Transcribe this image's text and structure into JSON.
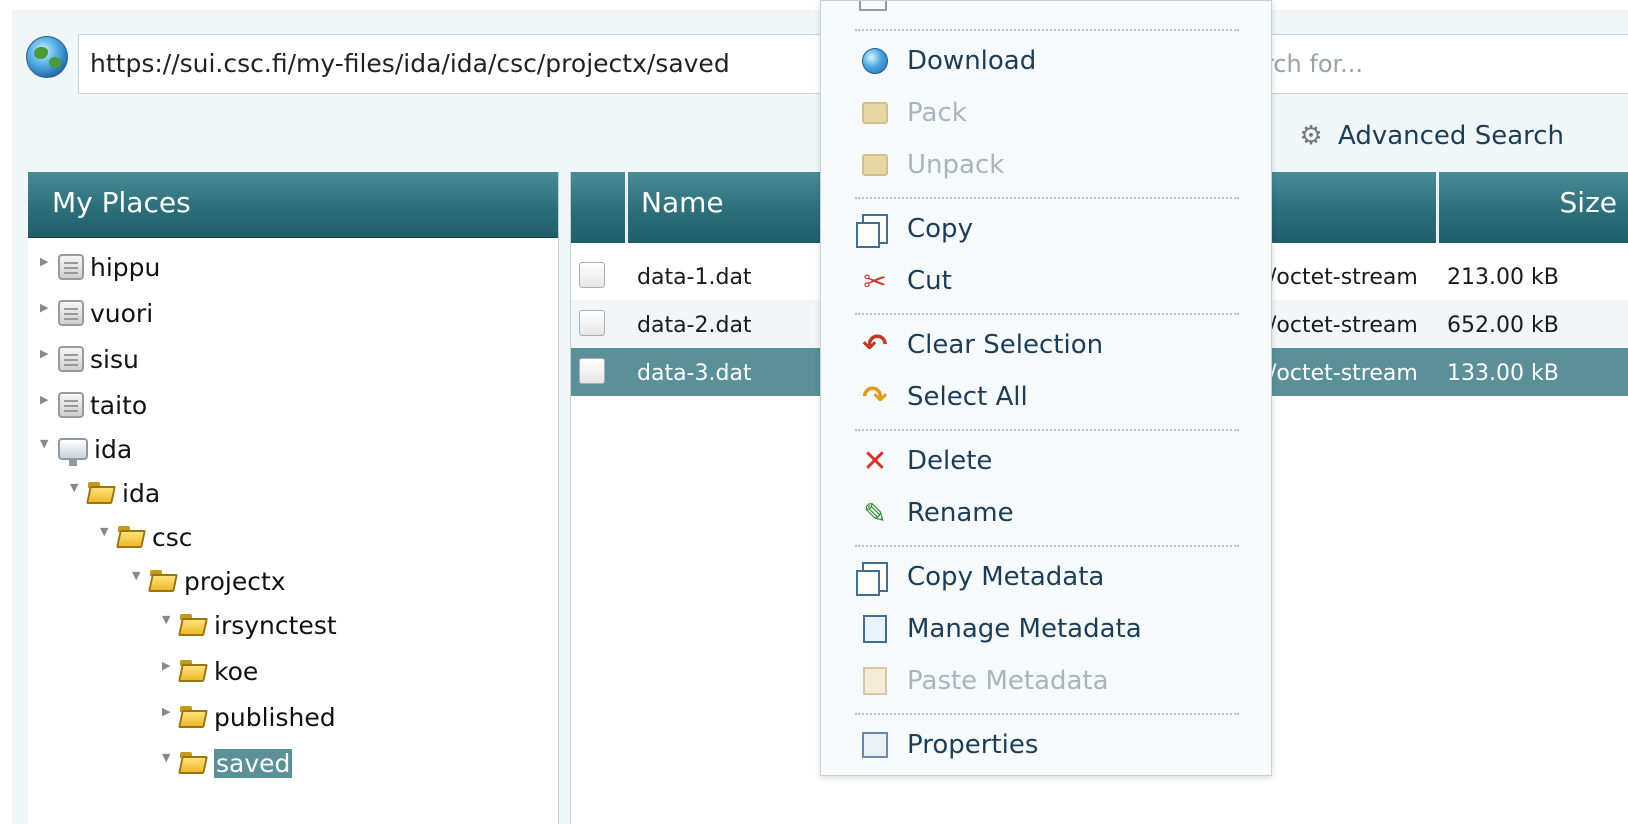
{
  "address_bar": {
    "url": "https://sui.csc.fi/my-files/ida/ida/csc/projectx/saved"
  },
  "search": {
    "placeholder": "rch for..."
  },
  "advanced_search": {
    "label": "Advanced Search",
    "icon": "gear-icon"
  },
  "places": {
    "title": "My Places",
    "items": [
      {
        "label": "hippu",
        "icon": "server-icon",
        "expanded": false
      },
      {
        "label": "vuori",
        "icon": "server-icon",
        "expanded": false
      },
      {
        "label": "sisu",
        "icon": "server-icon",
        "expanded": false
      },
      {
        "label": "taito",
        "icon": "server-icon",
        "expanded": false
      },
      {
        "label": "ida",
        "icon": "drive-icon",
        "expanded": true
      },
      {
        "label": "ida",
        "icon": "folder-icon",
        "expanded": true
      },
      {
        "label": "csc",
        "icon": "folder-icon",
        "expanded": true
      },
      {
        "label": "projectx",
        "icon": "folder-icon",
        "expanded": true
      },
      {
        "label": "irsynctest",
        "icon": "folder-icon",
        "expanded": true
      },
      {
        "label": "koe",
        "icon": "folder-icon",
        "expanded": false
      },
      {
        "label": "published",
        "icon": "folder-icon",
        "expanded": false
      },
      {
        "label": "saved",
        "icon": "folder-icon",
        "expanded": true,
        "selected": true
      }
    ]
  },
  "files": {
    "columns": {
      "name": "Name",
      "size": "Size"
    },
    "rows": [
      {
        "name": "data-1.dat",
        "type": "/octet-stream",
        "size": "213.00 kB",
        "selected": false
      },
      {
        "name": "data-2.dat",
        "type": "/octet-stream",
        "size": "652.00 kB",
        "selected": false
      },
      {
        "name": "data-3.dat",
        "type": "/octet-stream",
        "size": "133.00 kB",
        "selected": true
      }
    ]
  },
  "context_menu": {
    "items": [
      {
        "label": "Download",
        "icon": "globe-icon",
        "enabled": true
      },
      {
        "label": "Pack",
        "icon": "package-icon",
        "enabled": false
      },
      {
        "label": "Unpack",
        "icon": "package-icon",
        "enabled": false
      },
      {
        "label": "Copy",
        "icon": "copy-icon",
        "enabled": true
      },
      {
        "label": "Cut",
        "icon": "scissors-icon",
        "enabled": true
      },
      {
        "label": "Clear Selection",
        "icon": "undo-arrow-icon",
        "enabled": true
      },
      {
        "label": "Select All",
        "icon": "redo-arrow-icon",
        "enabled": true
      },
      {
        "label": "Delete",
        "icon": "x-icon",
        "enabled": true
      },
      {
        "label": "Rename",
        "icon": "pencil-icon",
        "enabled": true
      },
      {
        "label": "Copy Metadata",
        "icon": "copy-icon",
        "enabled": true
      },
      {
        "label": "Manage Metadata",
        "icon": "edit-document-icon",
        "enabled": true
      },
      {
        "label": "Paste Metadata",
        "icon": "clipboard-icon",
        "enabled": false
      },
      {
        "label": "Properties",
        "icon": "properties-icon",
        "enabled": true
      }
    ]
  },
  "colors": {
    "header_teal": "#2c6f7a",
    "selection": "#5b9098",
    "menu_text": "#1b3d57",
    "menu_disabled": "#a9b5bc"
  }
}
